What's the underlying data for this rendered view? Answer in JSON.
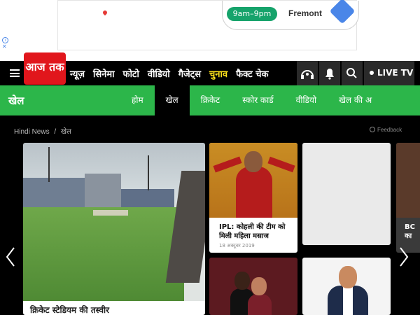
{
  "ad": {
    "time_badge": "9am–9pm",
    "city": "Fremont",
    "info": "i",
    "close": "✕"
  },
  "topnav": {
    "logo": "आज तक",
    "items": [
      "न्यूज़",
      "सिनेमा",
      "फोटो",
      "वीडियो",
      "गैजेट्स",
      "चुनाव",
      "फैक्ट चेक"
    ],
    "highlight_index": 5,
    "highlight_color": "#fde21b",
    "live_tv": "LIVE TV",
    "icons": [
      "podcast-icon",
      "bell-icon",
      "search-icon"
    ]
  },
  "section": {
    "title": "खेल",
    "tabs": [
      "होम",
      "खेल",
      "क्रिकेट",
      "स्कोर कार्ड",
      "वीडियो",
      "खेल की अ"
    ],
    "active_index": 1,
    "color": "#2cb64a"
  },
  "breadcrumb": {
    "items": [
      "Hindi News",
      "/",
      "खेल"
    ],
    "feedback": "Feedback"
  },
  "cards": {
    "main_caption": "क्रिकेट स्टेडियम की तस्वीर",
    "kohli": {
      "title": "IPL: कोहली की टीम को मिली महिला मसाज",
      "date": "18 अक्टूबर 2019"
    },
    "edge": {
      "title_line1": "BC",
      "title_line2": "का"
    }
  }
}
